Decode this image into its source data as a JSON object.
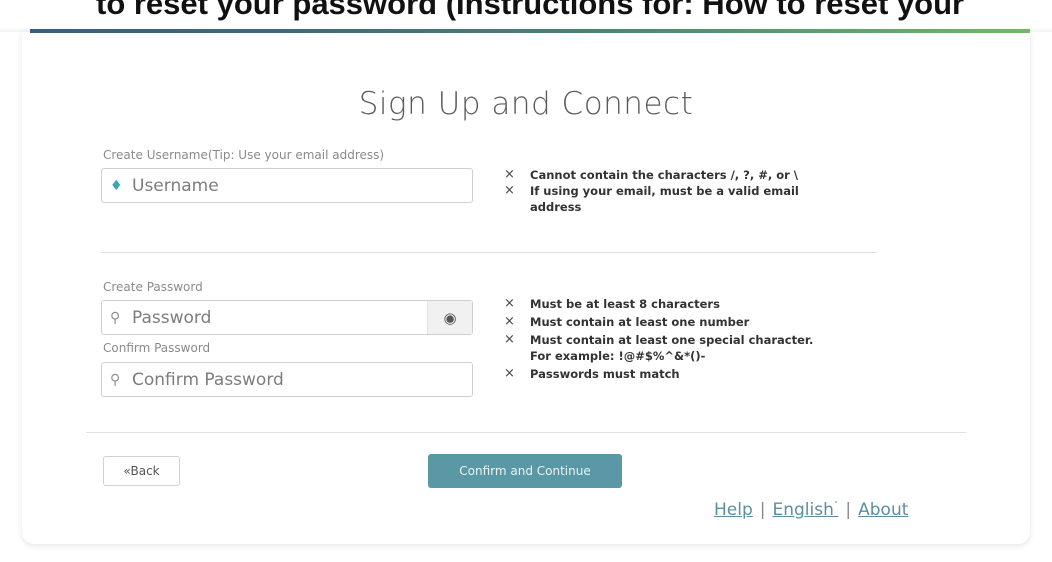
{
  "banner": {
    "text": "to reset your password (Instructions for: How to reset your"
  },
  "page": {
    "title": "Sign Up and Connect"
  },
  "username": {
    "label": "Create Username(Tip: Use your email address)",
    "placeholder": "Username",
    "icon": "gem-icon",
    "icon_color": "#3aa7b5",
    "rules": [
      {
        "mark": "×",
        "text": "Cannot contain the characters /, ?, #, or \\"
      },
      {
        "mark": "×",
        "text": "If using your email, must be a valid email",
        "sub": "address"
      }
    ]
  },
  "password": {
    "label": "Create Password",
    "placeholder": "Password",
    "icon": "key-icon",
    "toggle_icon": "eye-icon",
    "confirm_label": "Confirm Password",
    "confirm_placeholder": "Confirm Password",
    "rules": [
      {
        "mark": "×",
        "text": "Must be at least 8 characters"
      },
      {
        "mark": "×",
        "text": "Must contain at least one number"
      },
      {
        "mark": "×",
        "text": "Must contain at least one special character.",
        "sub": "For example: !@#$%^&*()-"
      },
      {
        "mark": "×",
        "text": "Passwords must match"
      }
    ]
  },
  "actions": {
    "back_label": "«Back",
    "confirm_label": "Confirm and Continue",
    "confirm_color": "#5b98a6"
  },
  "footer": {
    "help": "Help",
    "separator": "|",
    "language": "English",
    "language_caret": "ˇ",
    "about": "About"
  }
}
